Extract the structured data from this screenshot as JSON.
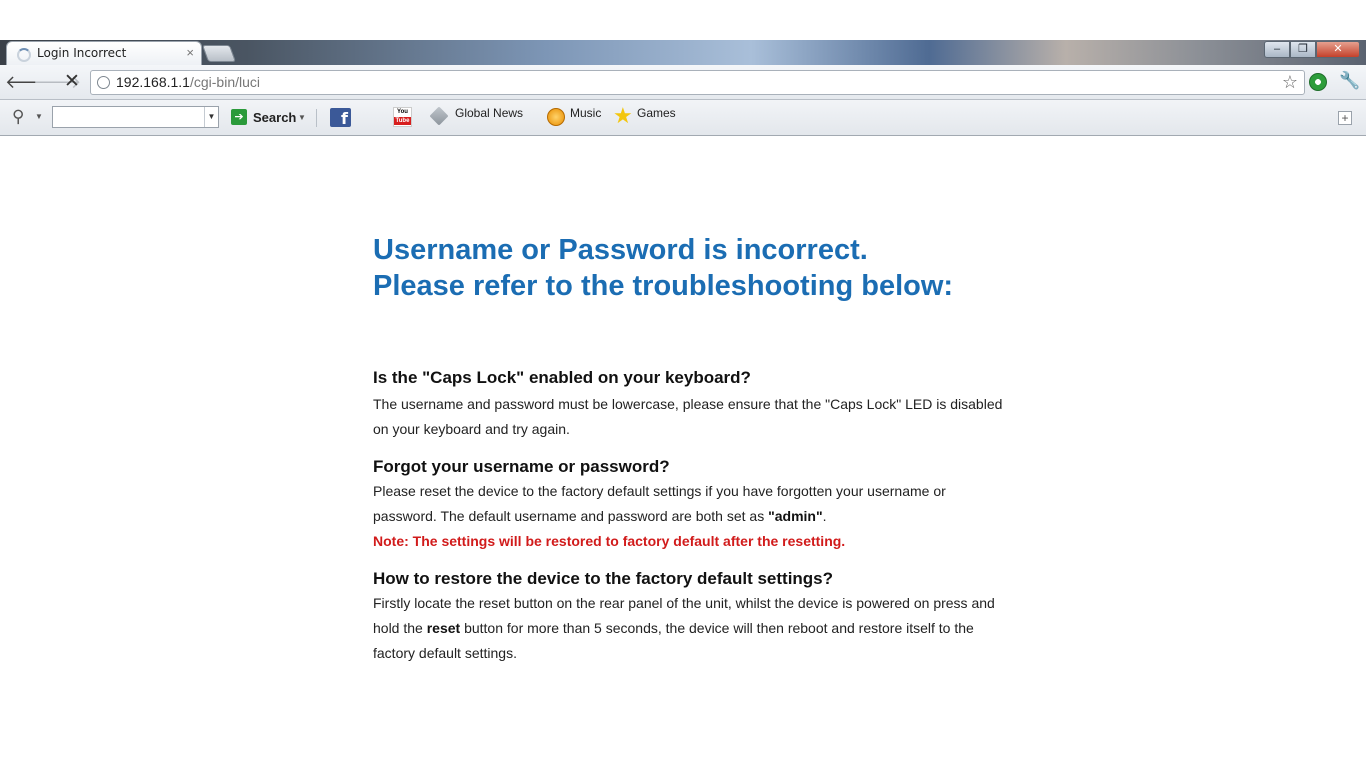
{
  "browser": {
    "tab_title": "Login Incorrect",
    "tab_close": "×",
    "url_host": "192.168.1.1",
    "url_path": "/cgi-bin/luci",
    "window_controls": {
      "minimize": "–",
      "maximize": "❐",
      "close": "✕"
    }
  },
  "toolbar": {
    "search_label": "Search",
    "facebook_label": "f",
    "youtube_label": "You",
    "youtube_sub": "Tube",
    "bookmarks": [
      "Global News",
      "Music",
      "Games"
    ]
  },
  "page": {
    "headline_line1": "Username or Password is incorrect.",
    "headline_line2": "Please refer to the troubleshooting below:",
    "sections": [
      {
        "question": "Is the \"Caps Lock\" enabled on your keyboard?",
        "text": "The username and password must be lowercase, please ensure that the \"Caps Lock\" LED is disabled on your keyboard and try again."
      },
      {
        "question": "Forgot your username or password?",
        "text_before": "Please reset the device to the factory default settings if you have forgotten your username or password. The default username and password are both set as ",
        "text_bold": "\"admin\"",
        "text_after": ".",
        "note": "Note: The settings will be restored to factory default after the resetting."
      },
      {
        "question": "How to restore the device to the factory default settings?",
        "text_before": "Firstly locate the reset button on the rear panel of the unit, whilst the device is powered on press and hold the ",
        "text_bold": "reset",
        "text_after": " button for more than 5 seconds, the device will then reboot and restore itself to the factory default settings."
      }
    ]
  },
  "colors": {
    "headline": "#1b6db3",
    "note": "#d11b1b"
  }
}
